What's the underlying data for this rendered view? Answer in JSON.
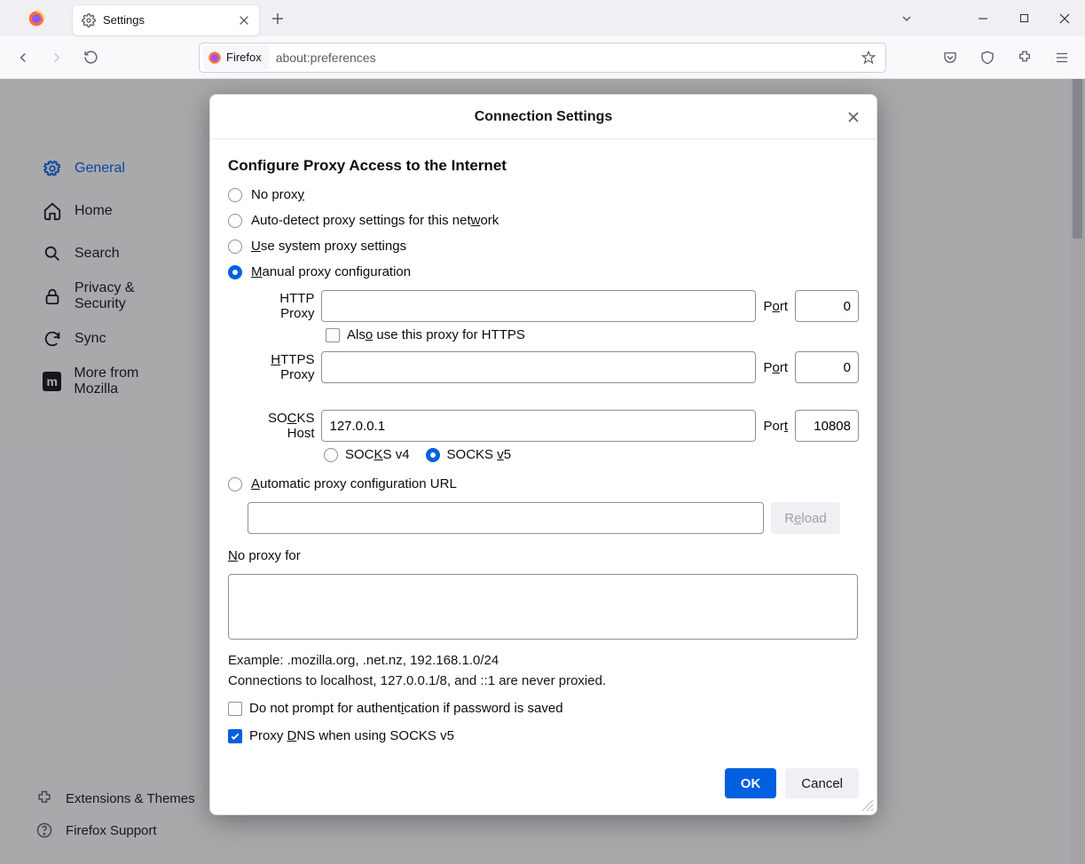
{
  "tab": {
    "title": "Settings"
  },
  "urlbar": {
    "identity": "Firefox",
    "url": "about:preferences"
  },
  "sidebar": {
    "items": [
      {
        "label": "General"
      },
      {
        "label": "Home"
      },
      {
        "label": "Search"
      },
      {
        "label": "Privacy & Security"
      },
      {
        "label": "Sync"
      },
      {
        "label": "More from Mozilla",
        "badge": "m"
      }
    ],
    "bottom": [
      {
        "label": "Extensions & Themes"
      },
      {
        "label": "Firefox Support"
      }
    ]
  },
  "dialog": {
    "title": "Connection Settings",
    "heading": "Configure Proxy Access to the Internet",
    "radios": {
      "no_proxy": "No prox",
      "no_proxy_u": "y",
      "auto_detect_pre": "Auto-detect proxy settings for this net",
      "auto_detect_u": "w",
      "auto_detect_post": "ork",
      "system_u": "U",
      "system_post": "se system proxy settings",
      "manual_u": "M",
      "manual_post": "anual proxy configuration",
      "auto_url_u": "A",
      "auto_url_post": "utomatic proxy configuration URL"
    },
    "http": {
      "label": "HTTP Proxy",
      "value": "",
      "port_label_pre": "P",
      "port_label_u": "o",
      "port_label_post": "rt",
      "port": "0"
    },
    "also_https": {
      "pre": "Als",
      "u": "o",
      "post": " use this proxy for HTTPS"
    },
    "https": {
      "label_u": "H",
      "label_post": "TTPS Proxy",
      "value": "",
      "port_label_pre": "P",
      "port_label_u": "o",
      "port_label_post": "rt",
      "port": "0"
    },
    "socks": {
      "label_pre": "SO",
      "label_u": "C",
      "label_post": "KS Host",
      "value": "127.0.0.1",
      "port_label_pre": "Por",
      "port_label_u": "t",
      "port": "10808"
    },
    "socks_ver": {
      "v4_pre": "SOC",
      "v4_u": "K",
      "v4_post": "S v4",
      "v5_pre": "SOCKS ",
      "v5_u": "v",
      "v5_post": "5"
    },
    "pac_url": "",
    "reload": {
      "pre": "R",
      "u": "e",
      "post": "load"
    },
    "noproxy_label_u": "N",
    "noproxy_label_post": "o proxy for",
    "noproxy_value": "",
    "example": "Example: .mozilla.org, .net.nz, 192.168.1.0/24",
    "localhost_note": "Connections to localhost, 127.0.0.1/8, and ::1 are never proxied.",
    "noprompt": {
      "pre": "Do not prompt for authent",
      "u": "i",
      "post": "cation if password is saved"
    },
    "proxydns": {
      "pre": "Proxy ",
      "u": "D",
      "post": "NS when using SOCKS v5"
    },
    "ok": "OK",
    "cancel": "Cancel"
  }
}
